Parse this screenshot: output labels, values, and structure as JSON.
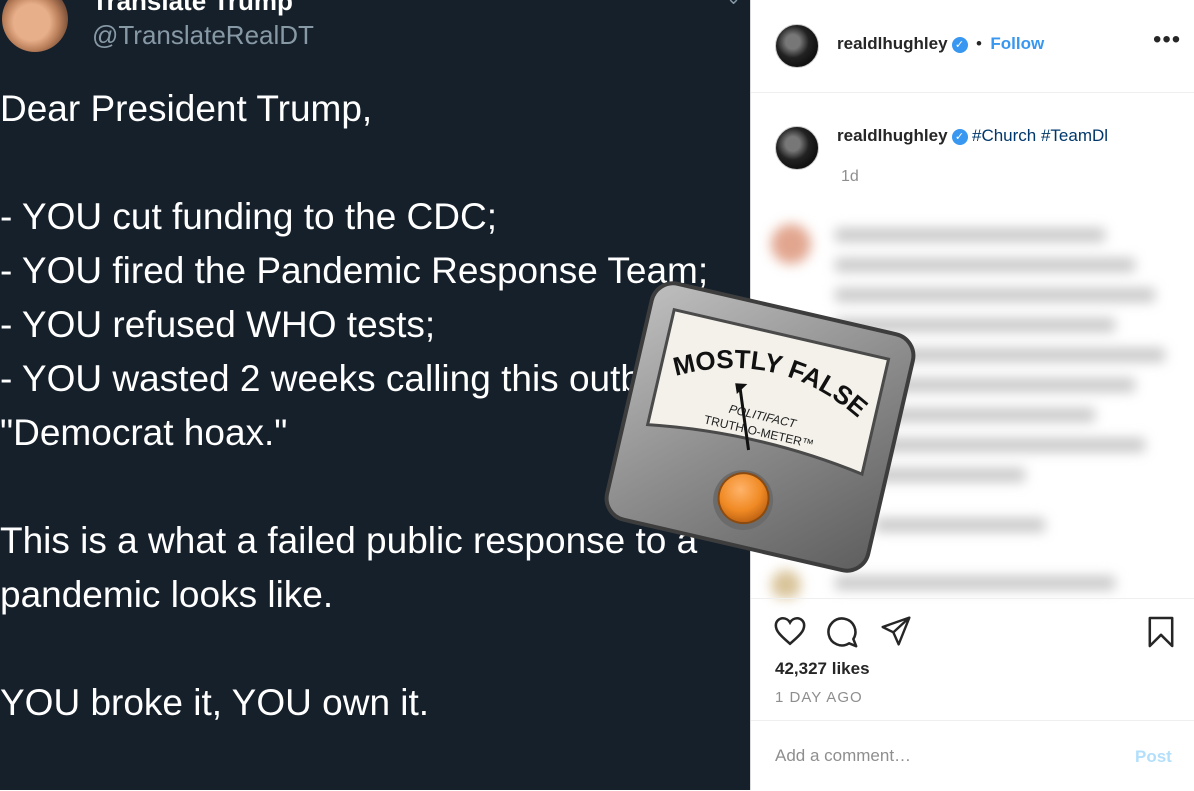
{
  "tweet": {
    "author_name": "Translate Trump",
    "author_handle": "@TranslateRealDT",
    "body": "Dear President Trump,\n\n- YOU cut funding to the CDC;\n- YOU fired the Pandemic Response Team;\n- YOU refused WHO tests;\n- YOU wasted 2 weeks calling this outbreak a \"Democrat hoax.\"\n\nThis is a what a failed public response to a pandemic looks like.\n\nYOU broke it, YOU own it."
  },
  "instagram": {
    "header": {
      "username": "realdlhughley",
      "separator": "•",
      "follow_label": "Follow",
      "more_label": "•••"
    },
    "caption": {
      "username": "realdlhughley",
      "hashtags": "#Church #TeamDl",
      "time": "1d"
    },
    "likes": "42,327 likes",
    "posted": "1 DAY AGO",
    "comment": {
      "placeholder": "Add a comment…",
      "post_label": "Post"
    }
  },
  "badge": {
    "rating": "MOSTLY FALSE",
    "brand_line1": "POLITIFACT",
    "brand_line2": "TRUTH-O-METER™"
  },
  "colors": {
    "tweet_bg": "#15202b",
    "instagram_blue": "#3897f0",
    "meter_knob": "#f08a24"
  }
}
